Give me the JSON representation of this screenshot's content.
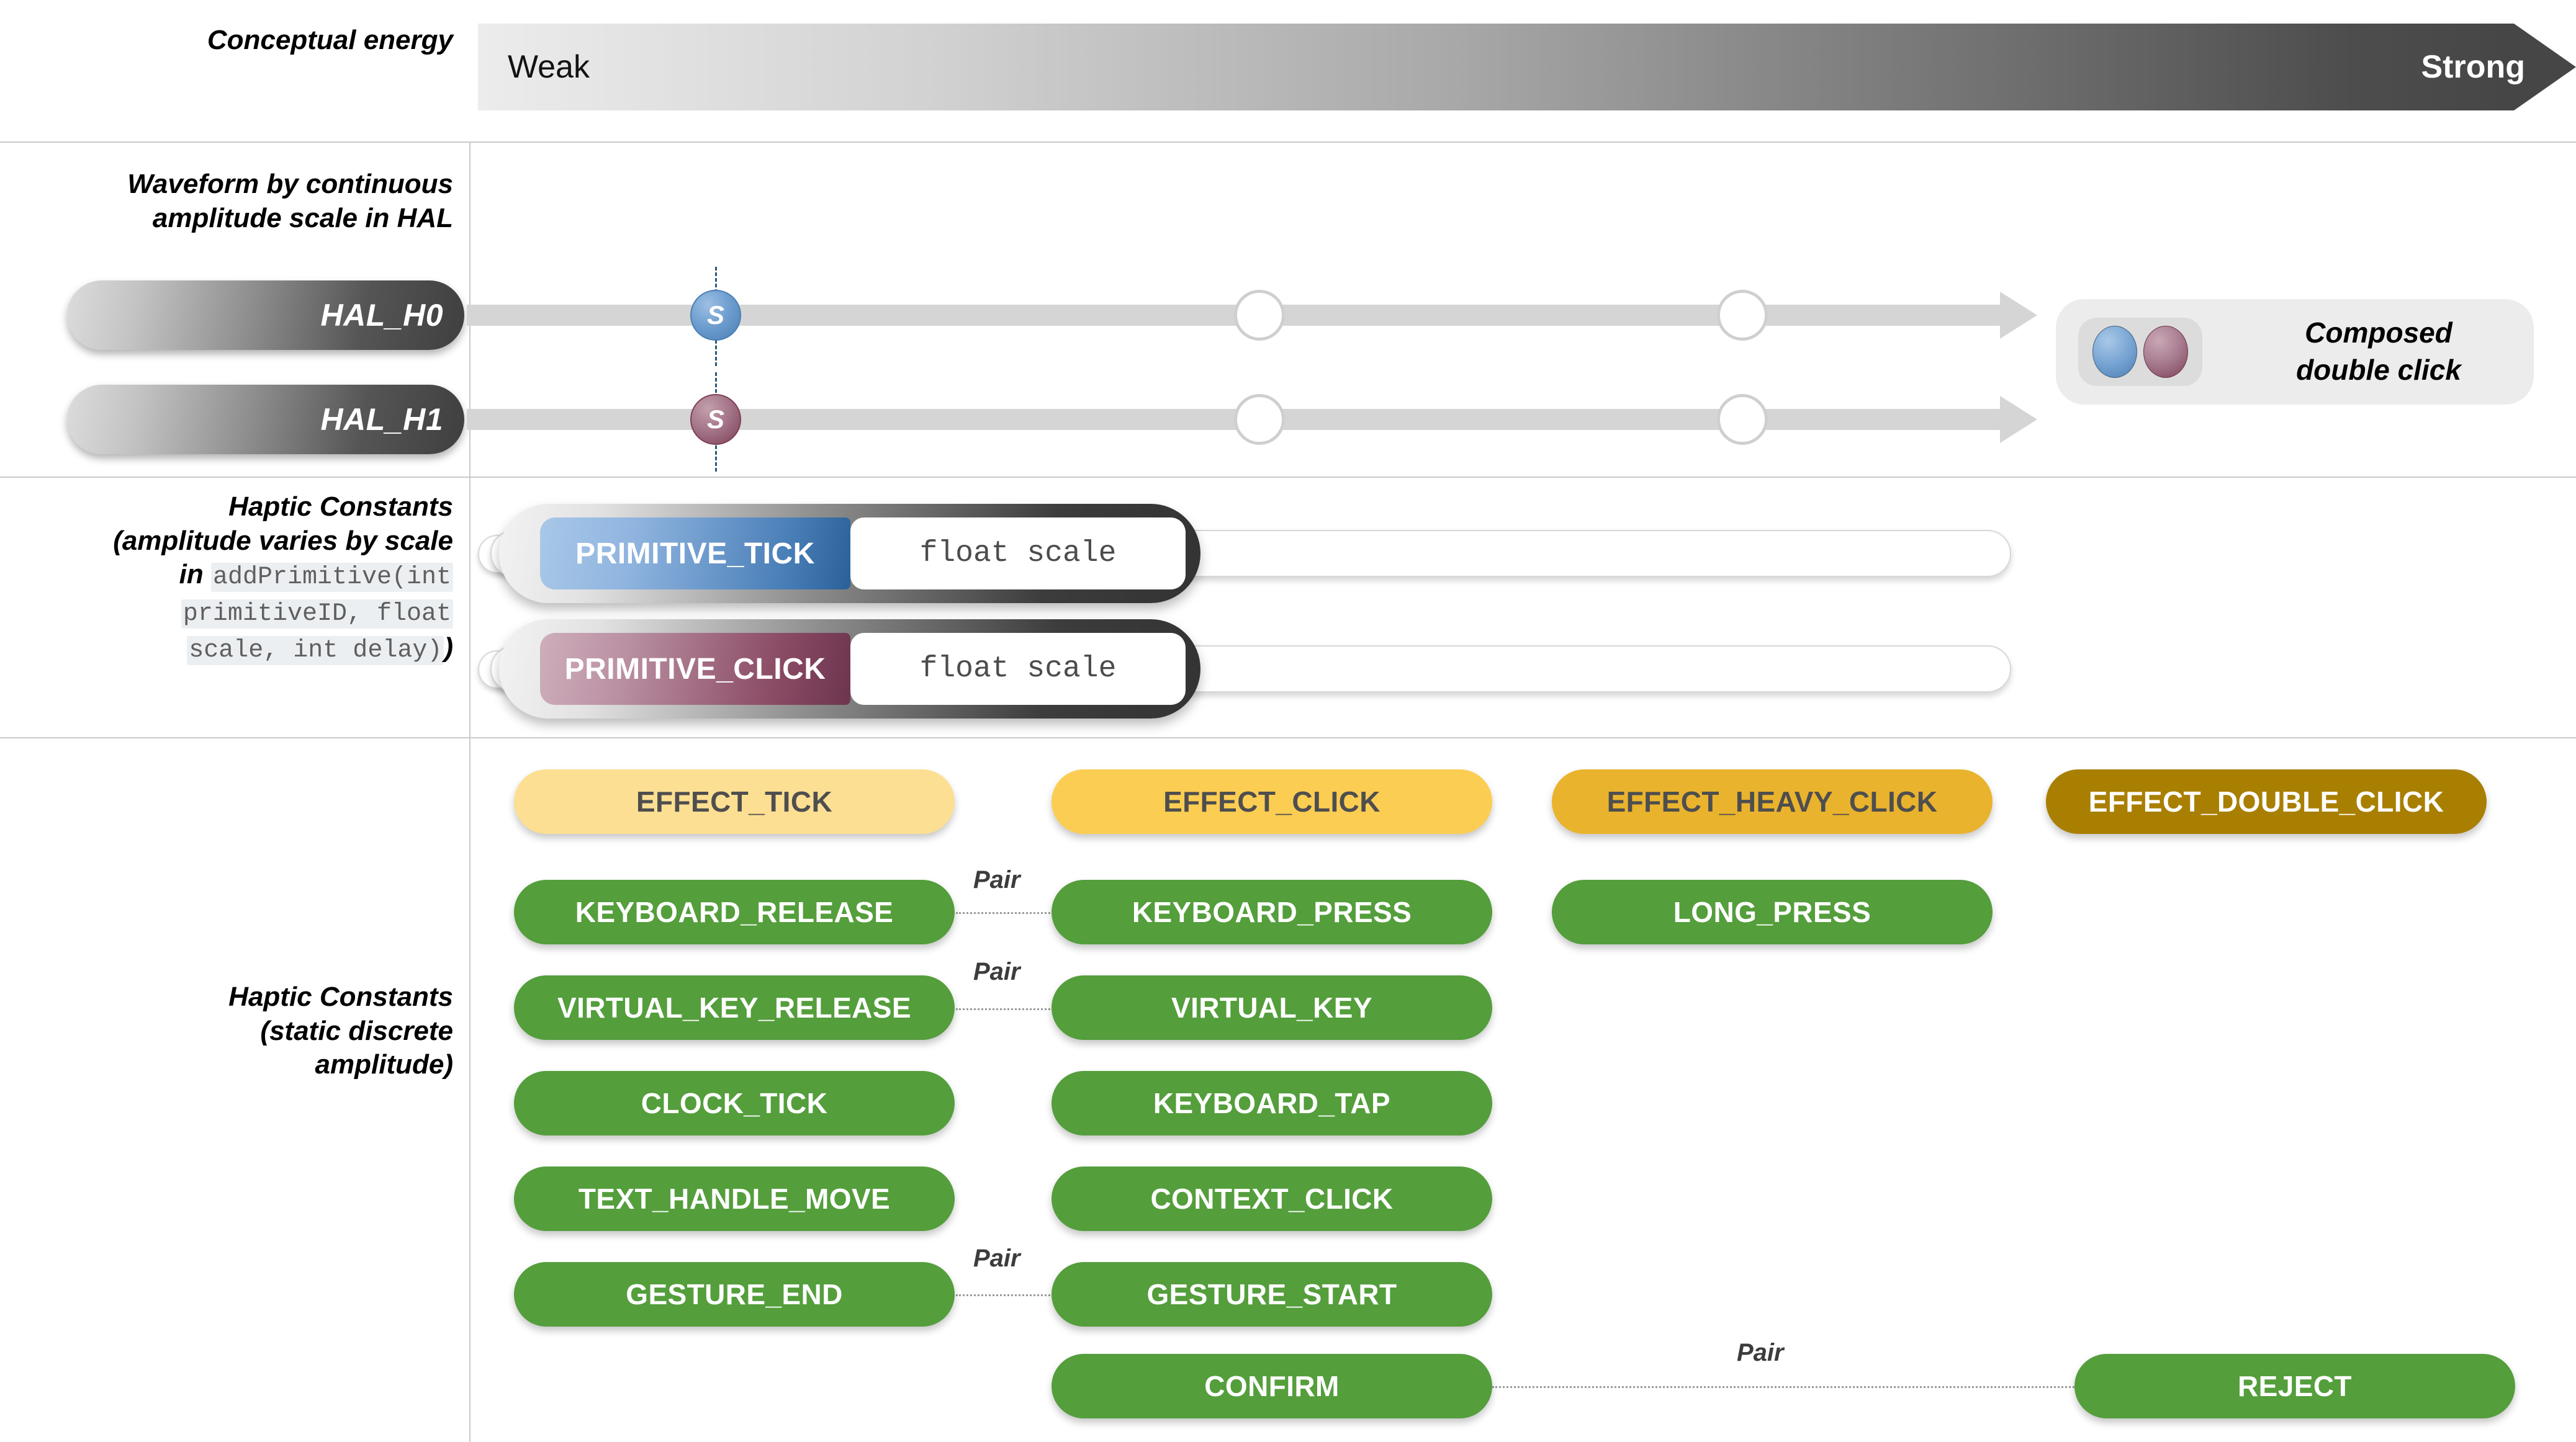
{
  "sections": {
    "energy": {
      "label": "Conceptual energy",
      "weak": "Weak",
      "strong": "Strong"
    },
    "waveform": {
      "label_line1": "Waveform by continuous",
      "label_line2": "amplitude scale in HAL",
      "hal_rows": [
        {
          "name": "HAL_H0",
          "marker": "S"
        },
        {
          "name": "HAL_H1",
          "marker": "S"
        }
      ],
      "composed": {
        "line1": "Composed",
        "line2": "double click"
      }
    },
    "primitives": {
      "label_line1": "Haptic Constants",
      "label_line2": "(amplitude varies by scale",
      "label_line3_prefix": "in ",
      "code_line1": "addPrimitive(int",
      "code_line2": "primitiveID, float",
      "code_line3": "scale, int delay)",
      "label_close": ")",
      "rows": [
        {
          "name": "PRIMITIVE_TICK",
          "arg": "float scale"
        },
        {
          "name": "PRIMITIVE_CLICK",
          "arg": "float scale"
        }
      ]
    },
    "static": {
      "label_line1": "Haptic Constants",
      "label_line2": "(static discrete",
      "label_line3": "amplitude)",
      "effects": [
        {
          "label": "EFFECT_TICK"
        },
        {
          "label": "EFFECT_CLICK"
        },
        {
          "label": "EFFECT_HEAVY_CLICK"
        },
        {
          "label": "EFFECT_DOUBLE_CLICK"
        }
      ],
      "constants": [
        {
          "label": "KEYBOARD_RELEASE"
        },
        {
          "label": "KEYBOARD_PRESS"
        },
        {
          "label": "LONG_PRESS"
        },
        {
          "label": "VIRTUAL_KEY_RELEASE"
        },
        {
          "label": "VIRTUAL_KEY"
        },
        {
          "label": "CLOCK_TICK"
        },
        {
          "label": "KEYBOARD_TAP"
        },
        {
          "label": "TEXT_HANDLE_MOVE"
        },
        {
          "label": "CONTEXT_CLICK"
        },
        {
          "label": "GESTURE_END"
        },
        {
          "label": "GESTURE_START"
        },
        {
          "label": "CONFIRM"
        },
        {
          "label": "REJECT"
        }
      ],
      "pair_labels": [
        {
          "text": "Pair"
        },
        {
          "text": "Pair"
        },
        {
          "text": "Pair"
        },
        {
          "text": "Pair"
        }
      ]
    }
  },
  "colors": {
    "green": "#549e3c",
    "effect_tick": "#fcdf92",
    "effect_click": "#fbcd52",
    "effect_heavy": "#eab32d",
    "effect_double": "#a97f01",
    "primitive_tick": "#4a7fb8",
    "primitive_click": "#8a4a64",
    "divider": "#c9c9c9"
  }
}
